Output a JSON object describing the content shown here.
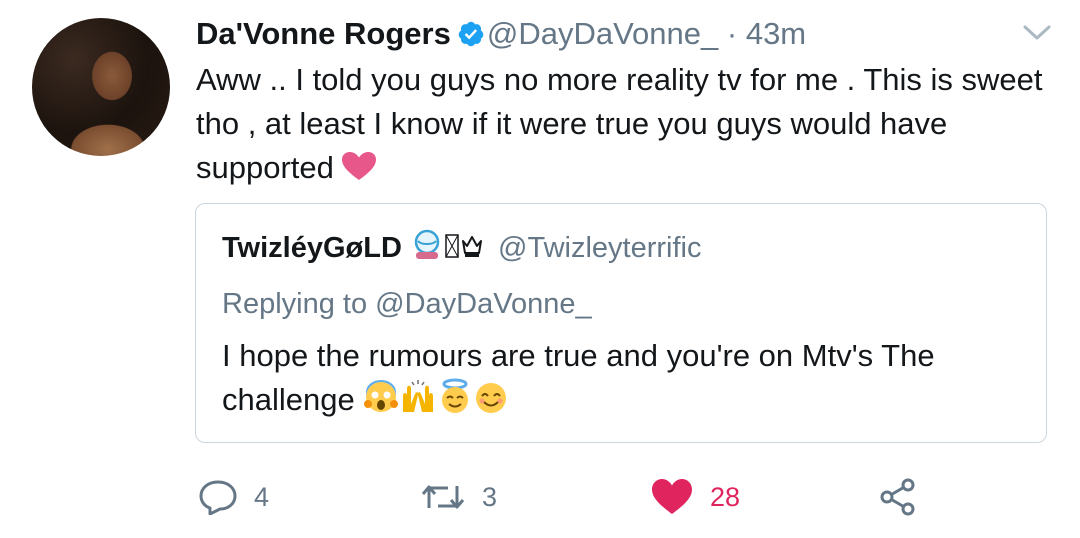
{
  "tweet": {
    "author_name": "Da'Vonne Rogers",
    "handle": "@DayDaVonne_",
    "separator": "·",
    "time": "43m",
    "text": "Aww .. I told you guys no more reality tv for me . This is sweet tho , at least I know if it were true you guys would have supported"
  },
  "quoted_tweet": {
    "author_name": "TwizléyGøLD",
    "handle": "@Twizleyterrific",
    "replying_to": "Replying to @DayDaVonne_",
    "text": "I hope the rumours are true and you're on Mtv's The challenge"
  },
  "actions": {
    "reply_count": "4",
    "retweet_count": "3",
    "like_count": "28"
  },
  "colors": {
    "accent": "#1da1f2",
    "like": "#e0245e",
    "muted": "#657786",
    "border": "#ccd6dd"
  },
  "icons": [
    "verified-badge-icon",
    "chevron-down-icon",
    "heart-emoji-icon",
    "crystal-ball-emoji-icon",
    "crown-emoji-icon",
    "scream-emoji-icon",
    "raised-hands-emoji-icon",
    "halo-face-emoji-icon",
    "smiling-face-emoji-icon",
    "reply-icon",
    "retweet-icon",
    "like-icon",
    "share-icon"
  ]
}
